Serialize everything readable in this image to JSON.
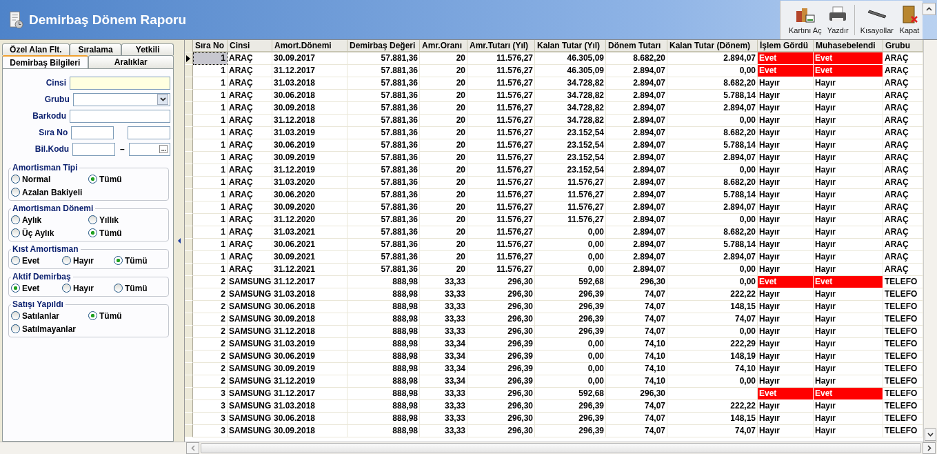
{
  "window": {
    "title": "Demirbaş Dönem Raporu"
  },
  "toolbar": [
    {
      "label": "Kartını Aç",
      "kind": "open"
    },
    {
      "label": "Yazdır",
      "kind": "print"
    },
    {
      "label": "Kısayollar",
      "kind": "keys"
    },
    {
      "label": "Kapat",
      "kind": "close"
    }
  ],
  "tabs_top": [
    {
      "label": "Özel Alan Flt.",
      "selected": false
    },
    {
      "label": "Sıralama",
      "selected": false
    },
    {
      "label": "Yetkili",
      "selected": false
    }
  ],
  "tabs_bottom": [
    {
      "label": "Demirbaş Bilgileri",
      "selected": true
    },
    {
      "label": "Aralıklar",
      "selected": false
    }
  ],
  "fields": [
    {
      "label": "Cinsi",
      "kind": "text",
      "highlighted": true
    },
    {
      "label": "Grubu",
      "kind": "select",
      "highlighted": false
    },
    {
      "label": "Barkodu",
      "kind": "text",
      "highlighted": false
    },
    {
      "label": "Sıra No",
      "kind": "range",
      "highlighted": false
    },
    {
      "label": "Bil.Kodu",
      "kind": "range-lookup",
      "separator": "–",
      "highlighted": false
    }
  ],
  "radio_groups": [
    {
      "title": "Amortisman Tipi",
      "kind": "grid2",
      "options": [
        {
          "label": "Normal",
          "selected": false
        },
        {
          "label": "Tümü",
          "selected": true
        },
        {
          "label": "Azalan Bakiyeli",
          "selected": false
        }
      ]
    },
    {
      "title": "Amortisman Dönemi",
      "kind": "grid2",
      "options": [
        {
          "label": "Aylık",
          "selected": false
        },
        {
          "label": "Yıllık",
          "selected": false
        },
        {
          "label": "Üç Aylık",
          "selected": false
        },
        {
          "label": "Tümü",
          "selected": true
        }
      ]
    },
    {
      "title": "Kıst Amortisman",
      "kind": "row3",
      "options": [
        {
          "label": "Evet",
          "selected": false
        },
        {
          "label": "Hayır",
          "selected": false
        },
        {
          "label": "Tümü",
          "selected": true
        }
      ]
    },
    {
      "title": "Aktif Demirbaş",
      "kind": "row3",
      "options": [
        {
          "label": "Evet",
          "selected": true
        },
        {
          "label": "Hayır",
          "selected": false
        },
        {
          "label": "Tümü",
          "selected": false
        }
      ]
    },
    {
      "title": "Satışı Yapıldı",
      "kind": "grid2",
      "options": [
        {
          "label": "Satılanlar",
          "selected": false
        },
        {
          "label": "Tümü",
          "selected": true
        },
        {
          "label": "Satılmayanlar",
          "selected": false
        }
      ]
    }
  ],
  "table": {
    "columns": [
      "Sıra No",
      "Cinsi",
      "Amort.Dönemi",
      "Demirbaş Değeri",
      "Amr.Oranı",
      "Amr.Tutarı (Yıl)",
      "Kalan Tutar (Yıl)",
      "Dönem Tutarı",
      "Kalan Tutar (Dönem)",
      "İşlem Gördü",
      "Muhasebelendi",
      "Grubu"
    ],
    "rows": [
      {
        "selected": true,
        "flagged": true,
        "cells": [
          "1",
          "ARAÇ",
          "30.09.2017",
          "57.881,36",
          "20",
          "11.576,27",
          "46.305,09",
          "8.682,20",
          "2.894,07",
          "Evet",
          "Evet",
          "ARAÇ"
        ]
      },
      {
        "selected": false,
        "flagged": true,
        "cells": [
          "1",
          "ARAÇ",
          "31.12.2017",
          "57.881,36",
          "20",
          "11.576,27",
          "46.305,09",
          "2.894,07",
          "0,00",
          "Evet",
          "Evet",
          "ARAÇ"
        ]
      },
      {
        "selected": false,
        "flagged": false,
        "cells": [
          "1",
          "ARAÇ",
          "31.03.2018",
          "57.881,36",
          "20",
          "11.576,27",
          "34.728,82",
          "2.894,07",
          "8.682,20",
          "Hayır",
          "Hayır",
          "ARAÇ"
        ]
      },
      {
        "selected": false,
        "flagged": false,
        "cells": [
          "1",
          "ARAÇ",
          "30.06.2018",
          "57.881,36",
          "20",
          "11.576,27",
          "34.728,82",
          "2.894,07",
          "5.788,14",
          "Hayır",
          "Hayır",
          "ARAÇ"
        ]
      },
      {
        "selected": false,
        "flagged": false,
        "cells": [
          "1",
          "ARAÇ",
          "30.09.2018",
          "57.881,36",
          "20",
          "11.576,27",
          "34.728,82",
          "2.894,07",
          "2.894,07",
          "Hayır",
          "Hayır",
          "ARAÇ"
        ]
      },
      {
        "selected": false,
        "flagged": false,
        "cells": [
          "1",
          "ARAÇ",
          "31.12.2018",
          "57.881,36",
          "20",
          "11.576,27",
          "34.728,82",
          "2.894,07",
          "0,00",
          "Hayır",
          "Hayır",
          "ARAÇ"
        ]
      },
      {
        "selected": false,
        "flagged": false,
        "cells": [
          "1",
          "ARAÇ",
          "31.03.2019",
          "57.881,36",
          "20",
          "11.576,27",
          "23.152,54",
          "2.894,07",
          "8.682,20",
          "Hayır",
          "Hayır",
          "ARAÇ"
        ]
      },
      {
        "selected": false,
        "flagged": false,
        "cells": [
          "1",
          "ARAÇ",
          "30.06.2019",
          "57.881,36",
          "20",
          "11.576,27",
          "23.152,54",
          "2.894,07",
          "5.788,14",
          "Hayır",
          "Hayır",
          "ARAÇ"
        ]
      },
      {
        "selected": false,
        "flagged": false,
        "cells": [
          "1",
          "ARAÇ",
          "30.09.2019",
          "57.881,36",
          "20",
          "11.576,27",
          "23.152,54",
          "2.894,07",
          "2.894,07",
          "Hayır",
          "Hayır",
          "ARAÇ"
        ]
      },
      {
        "selected": false,
        "flagged": false,
        "cells": [
          "1",
          "ARAÇ",
          "31.12.2019",
          "57.881,36",
          "20",
          "11.576,27",
          "23.152,54",
          "2.894,07",
          "0,00",
          "Hayır",
          "Hayır",
          "ARAÇ"
        ]
      },
      {
        "selected": false,
        "flagged": false,
        "cells": [
          "1",
          "ARAÇ",
          "31.03.2020",
          "57.881,36",
          "20",
          "11.576,27",
          "11.576,27",
          "2.894,07",
          "8.682,20",
          "Hayır",
          "Hayır",
          "ARAÇ"
        ]
      },
      {
        "selected": false,
        "flagged": false,
        "cells": [
          "1",
          "ARAÇ",
          "30.06.2020",
          "57.881,36",
          "20",
          "11.576,27",
          "11.576,27",
          "2.894,07",
          "5.788,14",
          "Hayır",
          "Hayır",
          "ARAÇ"
        ]
      },
      {
        "selected": false,
        "flagged": false,
        "cells": [
          "1",
          "ARAÇ",
          "30.09.2020",
          "57.881,36",
          "20",
          "11.576,27",
          "11.576,27",
          "2.894,07",
          "2.894,07",
          "Hayır",
          "Hayır",
          "ARAÇ"
        ]
      },
      {
        "selected": false,
        "flagged": false,
        "cells": [
          "1",
          "ARAÇ",
          "31.12.2020",
          "57.881,36",
          "20",
          "11.576,27",
          "11.576,27",
          "2.894,07",
          "0,00",
          "Hayır",
          "Hayır",
          "ARAÇ"
        ]
      },
      {
        "selected": false,
        "flagged": false,
        "cells": [
          "1",
          "ARAÇ",
          "31.03.2021",
          "57.881,36",
          "20",
          "11.576,27",
          "0,00",
          "2.894,07",
          "8.682,20",
          "Hayır",
          "Hayır",
          "ARAÇ"
        ]
      },
      {
        "selected": false,
        "flagged": false,
        "cells": [
          "1",
          "ARAÇ",
          "30.06.2021",
          "57.881,36",
          "20",
          "11.576,27",
          "0,00",
          "2.894,07",
          "5.788,14",
          "Hayır",
          "Hayır",
          "ARAÇ"
        ]
      },
      {
        "selected": false,
        "flagged": false,
        "cells": [
          "1",
          "ARAÇ",
          "30.09.2021",
          "57.881,36",
          "20",
          "11.576,27",
          "0,00",
          "2.894,07",
          "2.894,07",
          "Hayır",
          "Hayır",
          "ARAÇ"
        ]
      },
      {
        "selected": false,
        "flagged": false,
        "cells": [
          "1",
          "ARAÇ",
          "31.12.2021",
          "57.881,36",
          "20",
          "11.576,27",
          "0,00",
          "2.894,07",
          "0,00",
          "Hayır",
          "Hayır",
          "ARAÇ"
        ]
      },
      {
        "selected": false,
        "flagged": true,
        "cells": [
          "2",
          "SAMSUNG",
          "31.12.2017",
          "888,98",
          "33,33",
          "296,30",
          "592,68",
          "296,30",
          "0,00",
          "Evet",
          "Evet",
          "TELEFO"
        ]
      },
      {
        "selected": false,
        "flagged": false,
        "cells": [
          "2",
          "SAMSUNG",
          "31.03.2018",
          "888,98",
          "33,33",
          "296,30",
          "296,39",
          "74,07",
          "222,22",
          "Hayır",
          "Hayır",
          "TELEFO"
        ]
      },
      {
        "selected": false,
        "flagged": false,
        "cells": [
          "2",
          "SAMSUNG",
          "30.06.2018",
          "888,98",
          "33,33",
          "296,30",
          "296,39",
          "74,07",
          "148,15",
          "Hayır",
          "Hayır",
          "TELEFO"
        ]
      },
      {
        "selected": false,
        "flagged": false,
        "cells": [
          "2",
          "SAMSUNG",
          "30.09.2018",
          "888,98",
          "33,33",
          "296,30",
          "296,39",
          "74,07",
          "74,07",
          "Hayır",
          "Hayır",
          "TELEFO"
        ]
      },
      {
        "selected": false,
        "flagged": false,
        "cells": [
          "2",
          "SAMSUNG",
          "31.12.2018",
          "888,98",
          "33,33",
          "296,30",
          "296,39",
          "74,07",
          "0,00",
          "Hayır",
          "Hayır",
          "TELEFO"
        ]
      },
      {
        "selected": false,
        "flagged": false,
        "cells": [
          "2",
          "SAMSUNG",
          "31.03.2019",
          "888,98",
          "33,34",
          "296,39",
          "0,00",
          "74,10",
          "222,29",
          "Hayır",
          "Hayır",
          "TELEFO"
        ]
      },
      {
        "selected": false,
        "flagged": false,
        "cells": [
          "2",
          "SAMSUNG",
          "30.06.2019",
          "888,98",
          "33,34",
          "296,39",
          "0,00",
          "74,10",
          "148,19",
          "Hayır",
          "Hayır",
          "TELEFO"
        ]
      },
      {
        "selected": false,
        "flagged": false,
        "cells": [
          "2",
          "SAMSUNG",
          "30.09.2019",
          "888,98",
          "33,34",
          "296,39",
          "0,00",
          "74,10",
          "74,10",
          "Hayır",
          "Hayır",
          "TELEFO"
        ]
      },
      {
        "selected": false,
        "flagged": false,
        "cells": [
          "2",
          "SAMSUNG",
          "31.12.2019",
          "888,98",
          "33,34",
          "296,39",
          "0,00",
          "74,10",
          "0,00",
          "Hayır",
          "Hayır",
          "TELEFO"
        ]
      },
      {
        "selected": false,
        "flagged": true,
        "cells": [
          "3",
          "SAMSUNG",
          "31.12.2017",
          "888,98",
          "33,33",
          "296,30",
          "592,68",
          "296,30",
          null,
          "Evet",
          "Evet",
          "TELEFO"
        ]
      },
      {
        "selected": false,
        "flagged": false,
        "cells": [
          "3",
          "SAMSUNG",
          "31.03.2018",
          "888,98",
          "33,33",
          "296,30",
          "296,39",
          "74,07",
          "222,22",
          "Hayır",
          "Hayır",
          "TELEFO"
        ]
      },
      {
        "selected": false,
        "flagged": false,
        "cells": [
          "3",
          "SAMSUNG",
          "30.06.2018",
          "888,98",
          "33,33",
          "296,30",
          "296,39",
          "74,07",
          "148,15",
          "Hayır",
          "Hayır",
          "TELEFO"
        ]
      },
      {
        "selected": false,
        "flagged": false,
        "cells": [
          "3",
          "SAMSUNG",
          "30.09.2018",
          "888,98",
          "33,33",
          "296,30",
          "296,39",
          "74,07",
          "74,07",
          "Hayır",
          "Hayır",
          "TELEFO"
        ]
      }
    ]
  }
}
